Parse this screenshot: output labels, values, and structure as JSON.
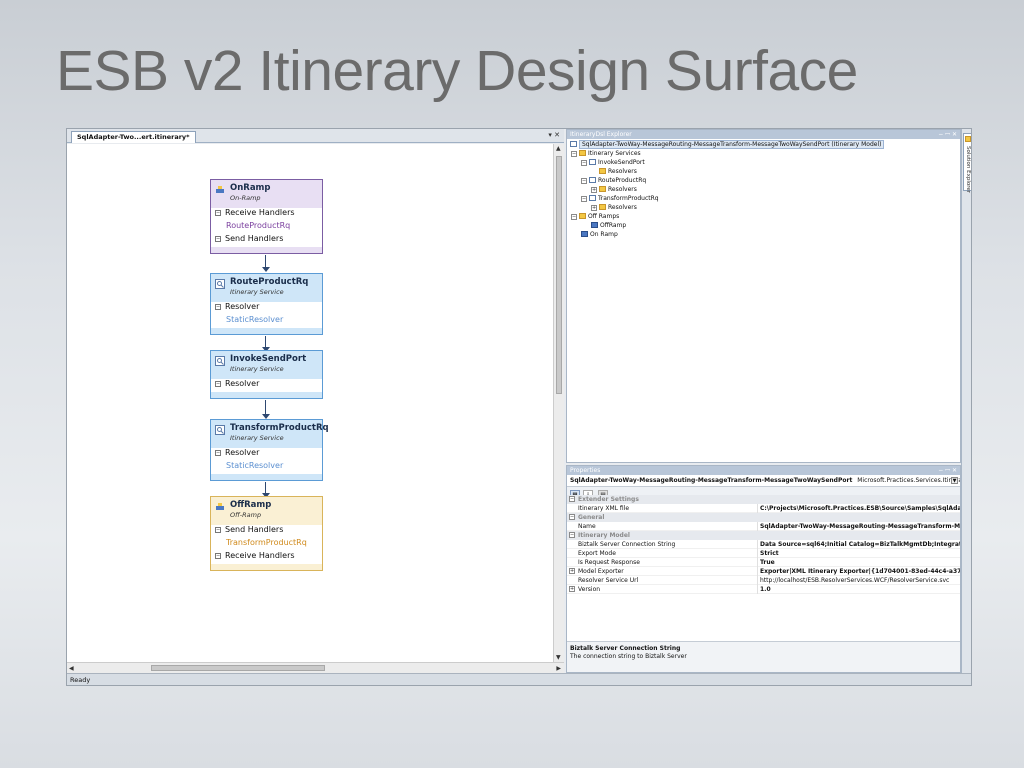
{
  "slide": {
    "title": "ESB v2 Itinerary Design Surface"
  },
  "document": {
    "tab_label": "SqlAdapter-Two...ert.itinerary*",
    "tab_controls": "▾ ✕"
  },
  "shapes": {
    "onramp": {
      "name": "OnRamp",
      "subtitle": "On-Ramp",
      "row1": "Receive Handlers",
      "item1": "RouteProductRq",
      "row2": "Send Handlers"
    },
    "route": {
      "name": "RouteProductRq",
      "subtitle": "Itinerary Service",
      "row1": "Resolver",
      "item1": "StaticResolver"
    },
    "invoke": {
      "name": "InvokeSendPort",
      "subtitle": "Itinerary Service",
      "row1": "Resolver"
    },
    "transform": {
      "name": "TransformProductRq",
      "subtitle": "Itinerary Service",
      "row1": "Resolver",
      "item1": "StaticResolver"
    },
    "offramp": {
      "name": "OffRamp",
      "subtitle": "Off-Ramp",
      "row1": "Send Handlers",
      "item1": "TransformProductRq",
      "row2": "Receive Handlers"
    }
  },
  "explorer": {
    "title": "ItineraryDsl Explorer",
    "controls": "− ꟷ ✕",
    "root": "SqlAdapter-TwoWay-MessageRouting-MessageTransform-MessageTwoWaySendPort (Itinerary Model)",
    "nodes": {
      "itinerary_services": "Itinerary Services",
      "invoke": "InvokeSendPort",
      "invoke_resolvers": "Resolvers",
      "route": "RouteProductRq",
      "route_resolvers": "Resolvers",
      "transform": "TransformProductRq",
      "transform_resolvers": "Resolvers",
      "off_ramps": "Off Ramps",
      "offramp": "OffRamp",
      "onramp": "On Ramp"
    }
  },
  "side_panel": {
    "tab": "Solution Explorer"
  },
  "properties": {
    "title": "Properties",
    "controls": "− ꟷ ✕",
    "object_name": "SqlAdapter-TwoWay-MessageRouting-MessageTransform-MessageTwoWaySendPort",
    "object_type": "Microsoft.Practices.Services.ItineraryDsl.Itine",
    "categories": {
      "extender": "Extender Settings",
      "general": "General",
      "itinerary_model": "Itinerary Model"
    },
    "rows": {
      "itinerary_xml_file": {
        "name": "Itinerary XML file",
        "value": "C:\\Projects\\Microsoft.Practices.ESB\\Source\\Samples\\SqlAdapter\\"
      },
      "name": {
        "name": "Name",
        "value": "SqlAdapter-TwoWay-MessageRouting-MessageTransform-Message"
      },
      "biztalk_conn": {
        "name": "Biztalk Server Connection String",
        "value": "Data Source=sql64;Initial Catalog=BizTalkMgmtDb;Integrated Sec"
      },
      "export_mode": {
        "name": "Export Mode",
        "value": "Strict"
      },
      "is_request_response": {
        "name": "Is Request Response",
        "value": "True"
      },
      "model_exporter": {
        "name": "Model Exporter",
        "value": "Exporter|XML Itinerary Exporter|{1d704001-83ed-44c4-a372-34"
      },
      "resolver_url": {
        "name": "Resolver Service Url",
        "value": "http://localhost/ESB.ResolverServices.WCF/ResolverService.svc"
      },
      "version": {
        "name": "Version",
        "value": "1.0"
      }
    },
    "description": {
      "title": "Biztalk Server Connection String",
      "text": "The connection string to Biztalk Server"
    }
  },
  "status": {
    "text": "Ready"
  },
  "colors": {
    "onramp_border": "#7b5da3",
    "onramp_head": "#e8dff3",
    "onramp_item": "#7a3f9e",
    "service_border": "#5b9bd5",
    "service_head": "#cfe6f8",
    "service_item": "#5b8fd0",
    "offramp_border": "#d9b45a",
    "offramp_head": "#faf0d4",
    "offramp_item": "#d08a1c"
  }
}
